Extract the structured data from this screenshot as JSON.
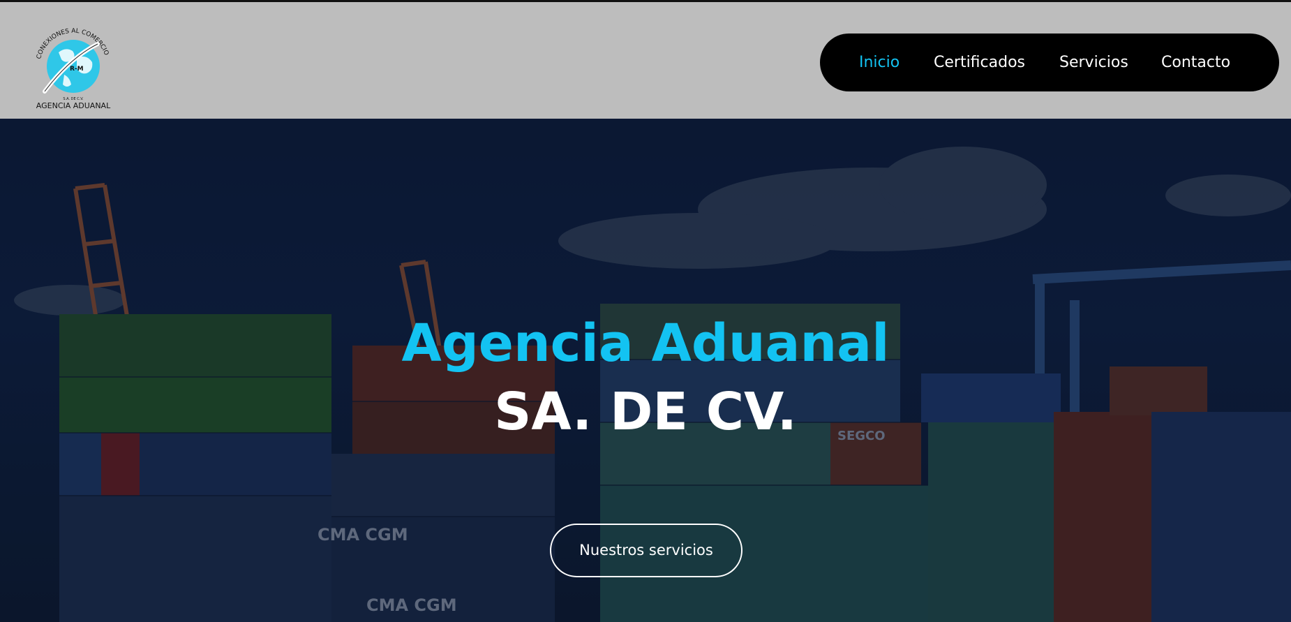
{
  "logo": {
    "arc_text": "CONEXIONES AL COMERCIO EXTERIOR",
    "monogram": "R-M",
    "small_text": "S.A. DE C.V.",
    "name": "AGENCIA ADUANAL"
  },
  "nav": {
    "items": [
      {
        "label": "Inicio",
        "active": true
      },
      {
        "label": "Certificados",
        "active": false
      },
      {
        "label": "Servicios",
        "active": false
      },
      {
        "label": "Contacto",
        "active": false
      }
    ]
  },
  "hero": {
    "title_line1": "Agencia Aduanal",
    "title_line2": "SA. DE CV.",
    "button_label": "Nuestros servicios",
    "background_subject": "shipping containers at port with cranes at dusk",
    "container_labels": [
      "CMA CGM",
      "CMA CGM",
      "SEGCO"
    ]
  },
  "colors": {
    "accent": "#13c3f2",
    "topbar": "#bdbdbd",
    "nav_bg": "#000000",
    "hero_overlay": "#0c1a33"
  }
}
